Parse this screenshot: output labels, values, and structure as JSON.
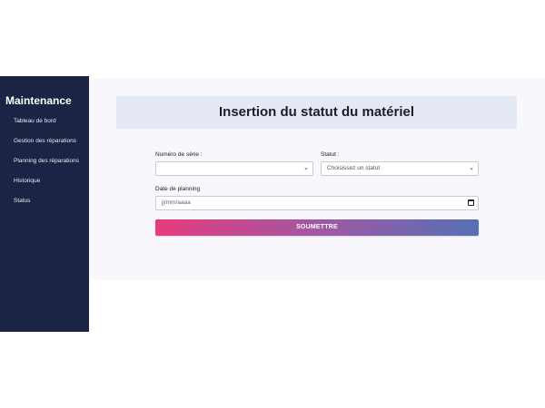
{
  "sidebar": {
    "title": "Maintenance",
    "items": [
      {
        "label": "Tableau de bord"
      },
      {
        "label": "Gestion des réparations"
      },
      {
        "label": "Planning des réparations"
      },
      {
        "label": "Historique"
      },
      {
        "label": "Status"
      }
    ]
  },
  "main": {
    "title": "Insertion du statut du matériel",
    "form": {
      "serial": {
        "label": "Numéro de série :",
        "value": ""
      },
      "status": {
        "label": "Statut :",
        "value": "Choisissez un statut"
      },
      "planning_date": {
        "label": "Date de planning",
        "placeholder": "jj/mm/aaaa"
      },
      "submit_label": "SOUMETTRE"
    }
  },
  "colors": {
    "sidebar_bg": "#1b2444",
    "header_bg": "#e5e9f5",
    "button_gradient_start": "#e63c7e",
    "button_gradient_end": "#5571b4"
  }
}
